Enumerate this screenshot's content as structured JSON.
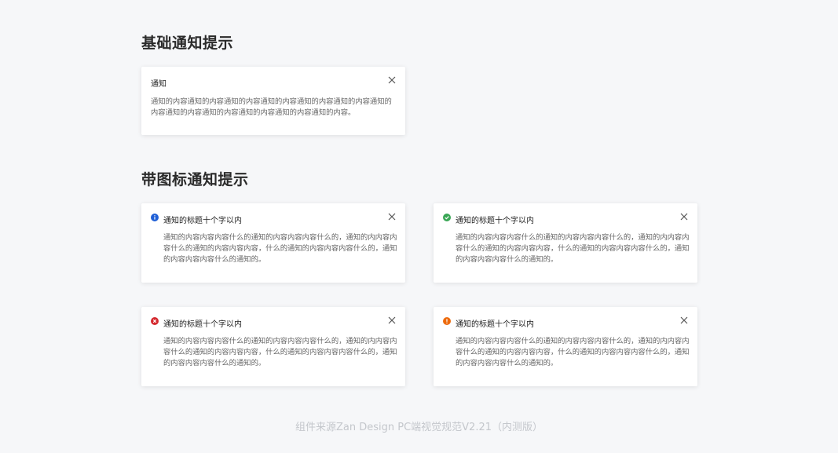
{
  "sections": {
    "basic_title": "基础通知提示",
    "icon_title": "带图标通知提示"
  },
  "basic_notification": {
    "title": "通知",
    "body": "通知的内容通知的内容通知的内容通知的内容通知的内容通知的内容通知的内容通知的内容通知的内容通知的内容通知的内容通知的内容。"
  },
  "icon_notifications": [
    {
      "type": "info",
      "icon": "info-icon",
      "color": "#1f5fd6",
      "title": "通知的标题十个字以内",
      "body": "通知的内容内容内容什么的通知的内容内容内容什么的，通知的内内容内容什么的通知的内容内容内容，什么的通知的内容内容内容什么的，通知的内容内容内容什么的通知的。"
    },
    {
      "type": "success",
      "icon": "check-circle-icon",
      "color": "#3aa655",
      "title": "通知的标题十个字以内",
      "body": "通知的内容内容内容什么的通知的内容内容内容什么的，通知的内内容内容什么的通知的内容内容内容，什么的通知的内容内容内容什么的，通知的内容内容内容什么的通知的。"
    },
    {
      "type": "error",
      "icon": "close-circle-icon",
      "color": "#d4282d",
      "title": "通知的标题十个字以内",
      "body": "通知的内容内容内容什么的通知的内容内容内容什么的，通知的内内容内容什么的通知的内容内容内容，什么的通知的内容内容内容什么的，通知的内容内容内容什么的通知的。"
    },
    {
      "type": "warning",
      "icon": "warning-circle-icon",
      "color": "#ed6a0c",
      "title": "通知的标题十个字以内",
      "body": "通知的内容内容内容什么的通知的内容内容内容什么的，通知的内内容内容什么的通知的内容内容内容，什么的通知的内容内容内容什么的，通知的内容内容内容什么的通知的。"
    }
  ],
  "footer": "组件来源Zan Design PC端视觉规范V2.21（内测版）"
}
